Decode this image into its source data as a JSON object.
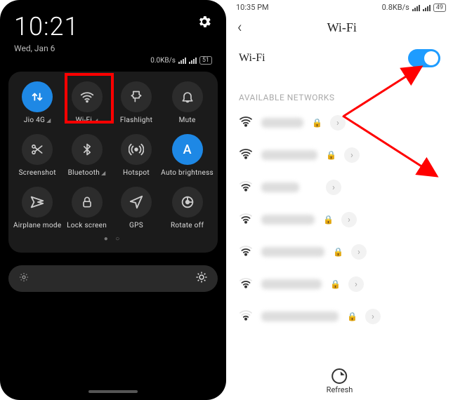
{
  "left": {
    "status": {
      "time": "10:21",
      "date": "Wed, Jan 6",
      "data_rate": "0.0KB/s",
      "battery": "51"
    },
    "tiles": [
      {
        "label": "Jio 4G",
        "sub": "◢",
        "icon": "data",
        "active": true
      },
      {
        "label": "Wi-Fi",
        "sub": "◢",
        "icon": "wifi",
        "active": false
      },
      {
        "label": "Flashlight",
        "sub": "",
        "icon": "flash",
        "active": false
      },
      {
        "label": "Mute",
        "sub": "",
        "icon": "bell",
        "active": false
      },
      {
        "label": "Screenshot",
        "sub": "",
        "icon": "scissors",
        "active": false
      },
      {
        "label": "Bluetooth",
        "sub": "◢",
        "icon": "bt",
        "active": false
      },
      {
        "label": "Hotspot",
        "sub": "",
        "icon": "hotspot",
        "active": false
      },
      {
        "label": "Auto brightness",
        "sub": "",
        "icon": "A",
        "active": true
      },
      {
        "label": "Airplane mode",
        "sub": "",
        "icon": "plane",
        "active": false
      },
      {
        "label": "Lock screen",
        "sub": "",
        "icon": "lock",
        "active": false
      },
      {
        "label": "GPS",
        "sub": "",
        "icon": "gps",
        "active": false
      },
      {
        "label": "Rotate off",
        "sub": "",
        "icon": "rotate",
        "active": false
      }
    ],
    "highlight_tile_index": 1
  },
  "right": {
    "status": {
      "time": "10:35 PM",
      "data_rate": "0.8KB/s",
      "battery": "49"
    },
    "title": "Wi-Fi",
    "wifi_label": "Wi-Fi",
    "wifi_on": true,
    "section": "AVAILABLE NETWORKS",
    "networks": [
      {
        "strength": 4,
        "locked": true
      },
      {
        "strength": 4,
        "locked": true
      },
      {
        "strength": 3,
        "locked": false
      },
      {
        "strength": 3,
        "locked": true
      },
      {
        "strength": 3,
        "locked": true
      },
      {
        "strength": 3,
        "locked": true
      },
      {
        "strength": 2,
        "locked": true
      }
    ],
    "refresh_label": "Refresh"
  }
}
